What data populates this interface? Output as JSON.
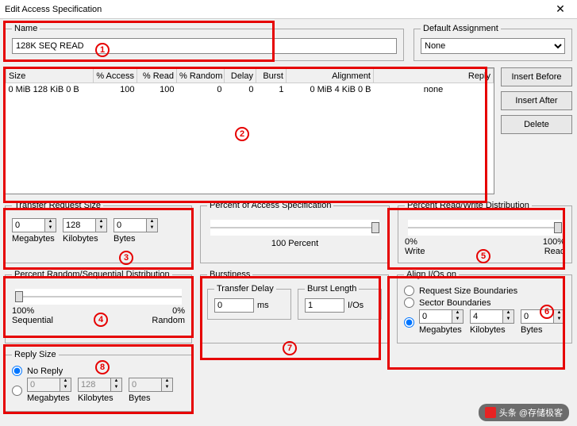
{
  "window": {
    "title": "Edit Access Specification",
    "close": "✕"
  },
  "name_group": {
    "legend": "Name",
    "value": "128K SEQ READ"
  },
  "default_assignment": {
    "legend": "Default Assignment",
    "value": "None"
  },
  "table": {
    "headers": [
      "Size",
      "% Access",
      "% Read",
      "% Random",
      "Delay",
      "Burst",
      "Alignment",
      "Reply"
    ],
    "row": {
      "size": "0 MiB  128 KiB  0 B",
      "access": "100",
      "read": "100",
      "random": "0",
      "delay": "0",
      "burst": "1",
      "alignment": "0 MiB   4 KiB   0 B",
      "reply": "none"
    }
  },
  "buttons": {
    "insert_before": "Insert Before",
    "insert_after": "Insert After",
    "delete": "Delete"
  },
  "trs": {
    "legend": "Transfer Request Size",
    "mb": {
      "value": "0",
      "label": "Megabytes"
    },
    "kb": {
      "value": "128",
      "label": "Kilobytes"
    },
    "b": {
      "value": "0",
      "label": "Bytes"
    }
  },
  "poas": {
    "legend": "Percent of Access Specification",
    "label": "100 Percent"
  },
  "prwd": {
    "legend": "Percent Read/Write Distribution",
    "left_pct": "0%",
    "left_lbl": "Write",
    "right_pct": "100%",
    "right_lbl": "Read"
  },
  "prsd": {
    "legend": "Percent Random/Sequential Distribution",
    "left_pct": "100%",
    "left_lbl": "Sequential",
    "right_pct": "0%",
    "right_lbl": "Random"
  },
  "burst": {
    "legend": "Burstiness",
    "td_legend": "Transfer Delay",
    "td_value": "0",
    "td_unit": "ms",
    "bl_legend": "Burst Length",
    "bl_value": "1",
    "bl_unit": "I/Os"
  },
  "align": {
    "legend": "Align I/Os on",
    "opt1": "Request Size Boundaries",
    "opt2": "Sector Boundaries",
    "mb": {
      "value": "0",
      "label": "Megabytes"
    },
    "kb": {
      "value": "4",
      "label": "Kilobytes"
    },
    "b": {
      "value": "0",
      "label": "Bytes"
    }
  },
  "reply": {
    "legend": "Reply Size",
    "noreply": "No Reply",
    "mb": {
      "value": "0",
      "label": "Megabytes"
    },
    "kb": {
      "value": "128",
      "label": "Kilobytes"
    },
    "b": {
      "value": "0",
      "label": "Bytes"
    }
  },
  "watermark": "头条 @存储极客",
  "annotations": {
    "1": "1",
    "2": "2",
    "3": "3",
    "4": "4",
    "5": "5",
    "6": "6",
    "7": "7",
    "8": "8"
  }
}
